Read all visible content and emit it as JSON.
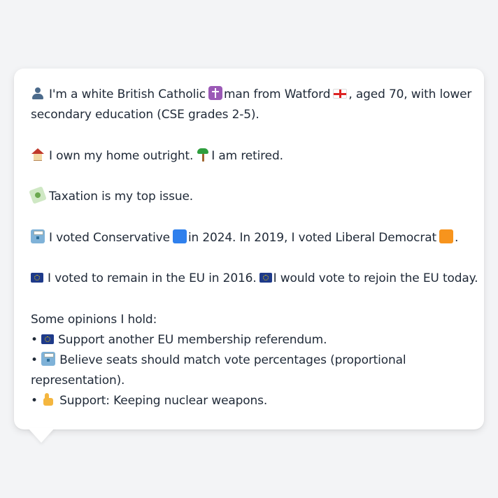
{
  "bubble": {
    "intro": {
      "p1": "I'm a white British Catholic",
      "p2": "man from Watford",
      "p3": ", aged 70, with lower",
      "p4": "secondary education (CSE grades 2-5)."
    },
    "home": {
      "p1": "I own my home outright.",
      "p2": "I am retired."
    },
    "issue": "Taxation is my top issue.",
    "vote": {
      "p1": "I voted Conservative",
      "p2": "in 2024. In 2019, I voted Liberal Democrat",
      "p3": "."
    },
    "eu": {
      "p1": "I voted to remain in the EU in 2016.",
      "p2": "I would vote to rejoin the EU today."
    },
    "opinions": {
      "heading": "Some opinions I hold:",
      "bullet": "•",
      "items": [
        "Support another EU membership referendum.",
        "Believe seats should match vote percentages (proportional",
        "representation).",
        "Support: Keeping nuclear weapons."
      ]
    }
  },
  "icons": {
    "person": "person-silhouette-icon",
    "cross": "latin-cross-icon",
    "england_flag": "england-flag-icon",
    "house": "house-icon",
    "palm": "palm-tree-icon",
    "money": "money-with-wings-icon",
    "ballot": "ballot-box-icon",
    "conservative": "blue-square-icon",
    "libdem": "orange-square-icon",
    "eu_flag": "eu-flag-icon",
    "thumb": "thumbs-up-icon"
  },
  "colors": {
    "background": "#f3f4f6",
    "bubble": "#ffffff",
    "text": "#1f2937",
    "conservative": "#2f80ed",
    "libdem": "#f7941d",
    "eu": "#1e3a8a"
  }
}
